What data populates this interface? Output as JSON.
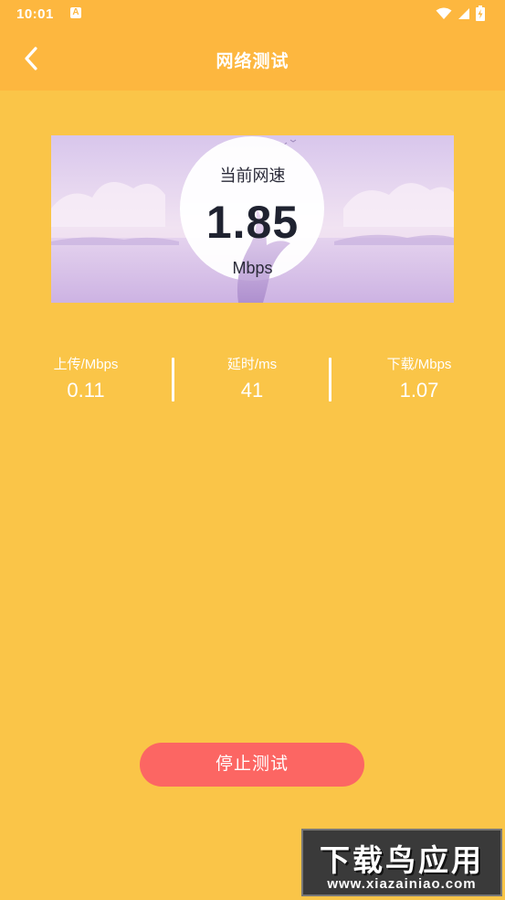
{
  "status_bar": {
    "time": "10:01",
    "notification_icon": "a-letter-icon",
    "wifi_icon": "wifi-icon",
    "signal_icon": "signal-icon",
    "battery_icon": "battery-charging-icon"
  },
  "app_bar": {
    "title": "网络测试",
    "back_icon": "chevron-left-icon",
    "color": "#FDB73F"
  },
  "speed_panel": {
    "label": "当前网速",
    "value": "1.85",
    "unit": "Mbps"
  },
  "stats": {
    "upload": {
      "label": "上传/Mbps",
      "value": "0.11"
    },
    "latency": {
      "label": "延时/ms",
      "value": "41"
    },
    "download": {
      "label": "下载/Mbps",
      "value": "1.07"
    }
  },
  "actions": {
    "stop_label": "停止测试",
    "stop_color": "#FC6663"
  },
  "watermark": {
    "title": "下载鸟应用",
    "url": "www.xiazainiao.com"
  },
  "colors": {
    "background": "#FAC548",
    "header": "#FDB73F"
  }
}
